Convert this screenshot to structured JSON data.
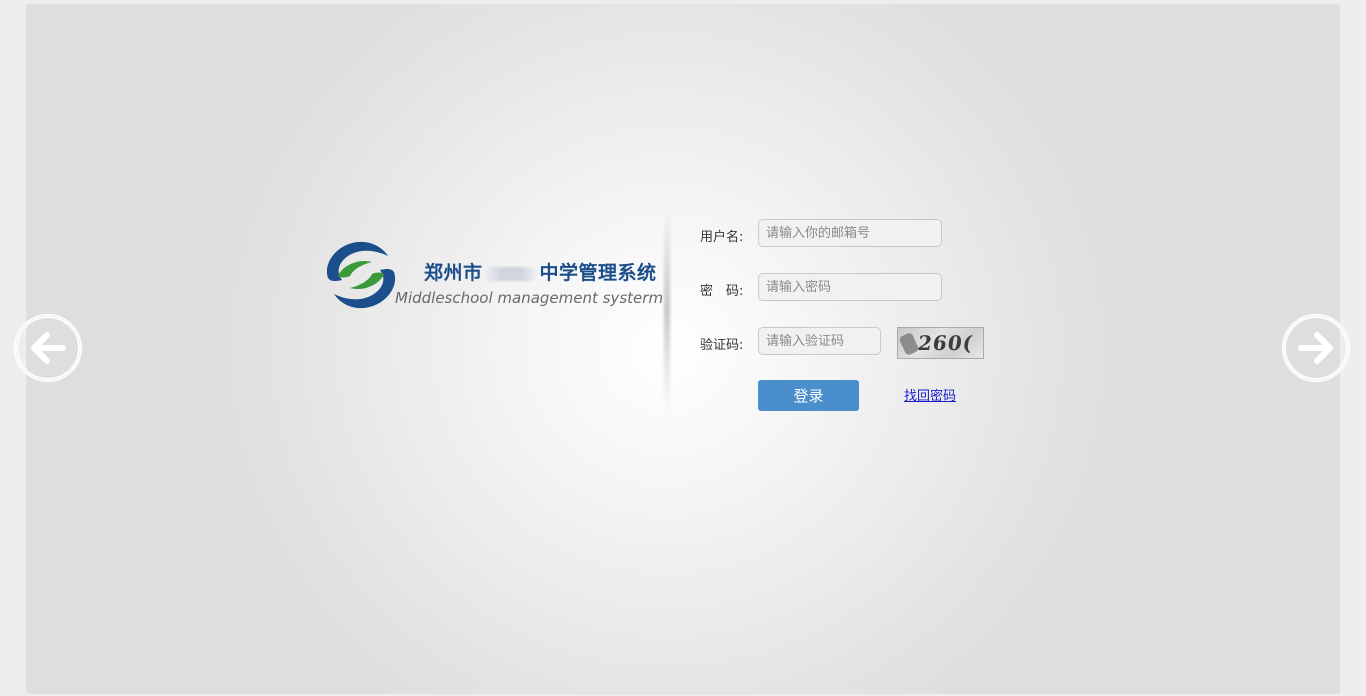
{
  "logo": {
    "title_prefix": "郑州市",
    "title_suffix": "中学管理系统",
    "subtitle": "Middleschool management systerm",
    "colors": {
      "blue": "#1b4e8a",
      "green": "#3a9a3a"
    }
  },
  "form": {
    "username_label": "用户名:",
    "username_placeholder": "请输入你的邮箱号",
    "password_label": "密　码:",
    "password_placeholder": "请输入密码",
    "captcha_label": "验证码:",
    "captcha_placeholder": "请输入验证码",
    "captcha_text": "260(",
    "login_label": "登录",
    "forgot_label": "找回密码"
  },
  "nav": {
    "prev_icon": "arrow-left-circle-icon",
    "next_icon": "arrow-right-circle-icon"
  },
  "colors": {
    "accent": "#4a8ecb",
    "link": "#1a1ad0"
  }
}
